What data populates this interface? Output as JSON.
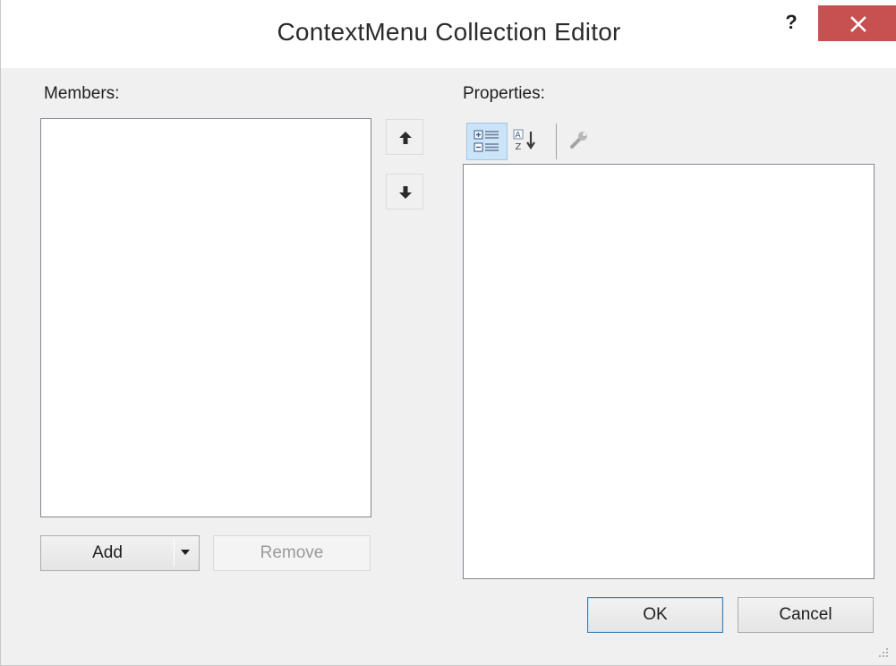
{
  "window": {
    "title": "ContextMenu Collection Editor",
    "help_label": "?",
    "close_icon": "close-icon"
  },
  "members": {
    "label": "Members:",
    "items": []
  },
  "order_buttons": {
    "up_icon": "arrow-up-icon",
    "down_icon": "arrow-down-icon"
  },
  "buttons": {
    "add_label": "Add",
    "remove_label": "Remove",
    "ok_label": "OK",
    "cancel_label": "Cancel"
  },
  "properties": {
    "label": "Properties:",
    "toolbar": [
      {
        "icon": "categorized-icon",
        "active": true
      },
      {
        "icon": "alphabetical-sort-icon",
        "active": false
      },
      {
        "icon": "property-pages-icon",
        "active": false
      }
    ]
  },
  "colors": {
    "close_button": "#c75050",
    "dialog_background": "#f0f0f0",
    "selected_tool": "#cce4f7",
    "default_button_border": "#3c7fb1"
  }
}
